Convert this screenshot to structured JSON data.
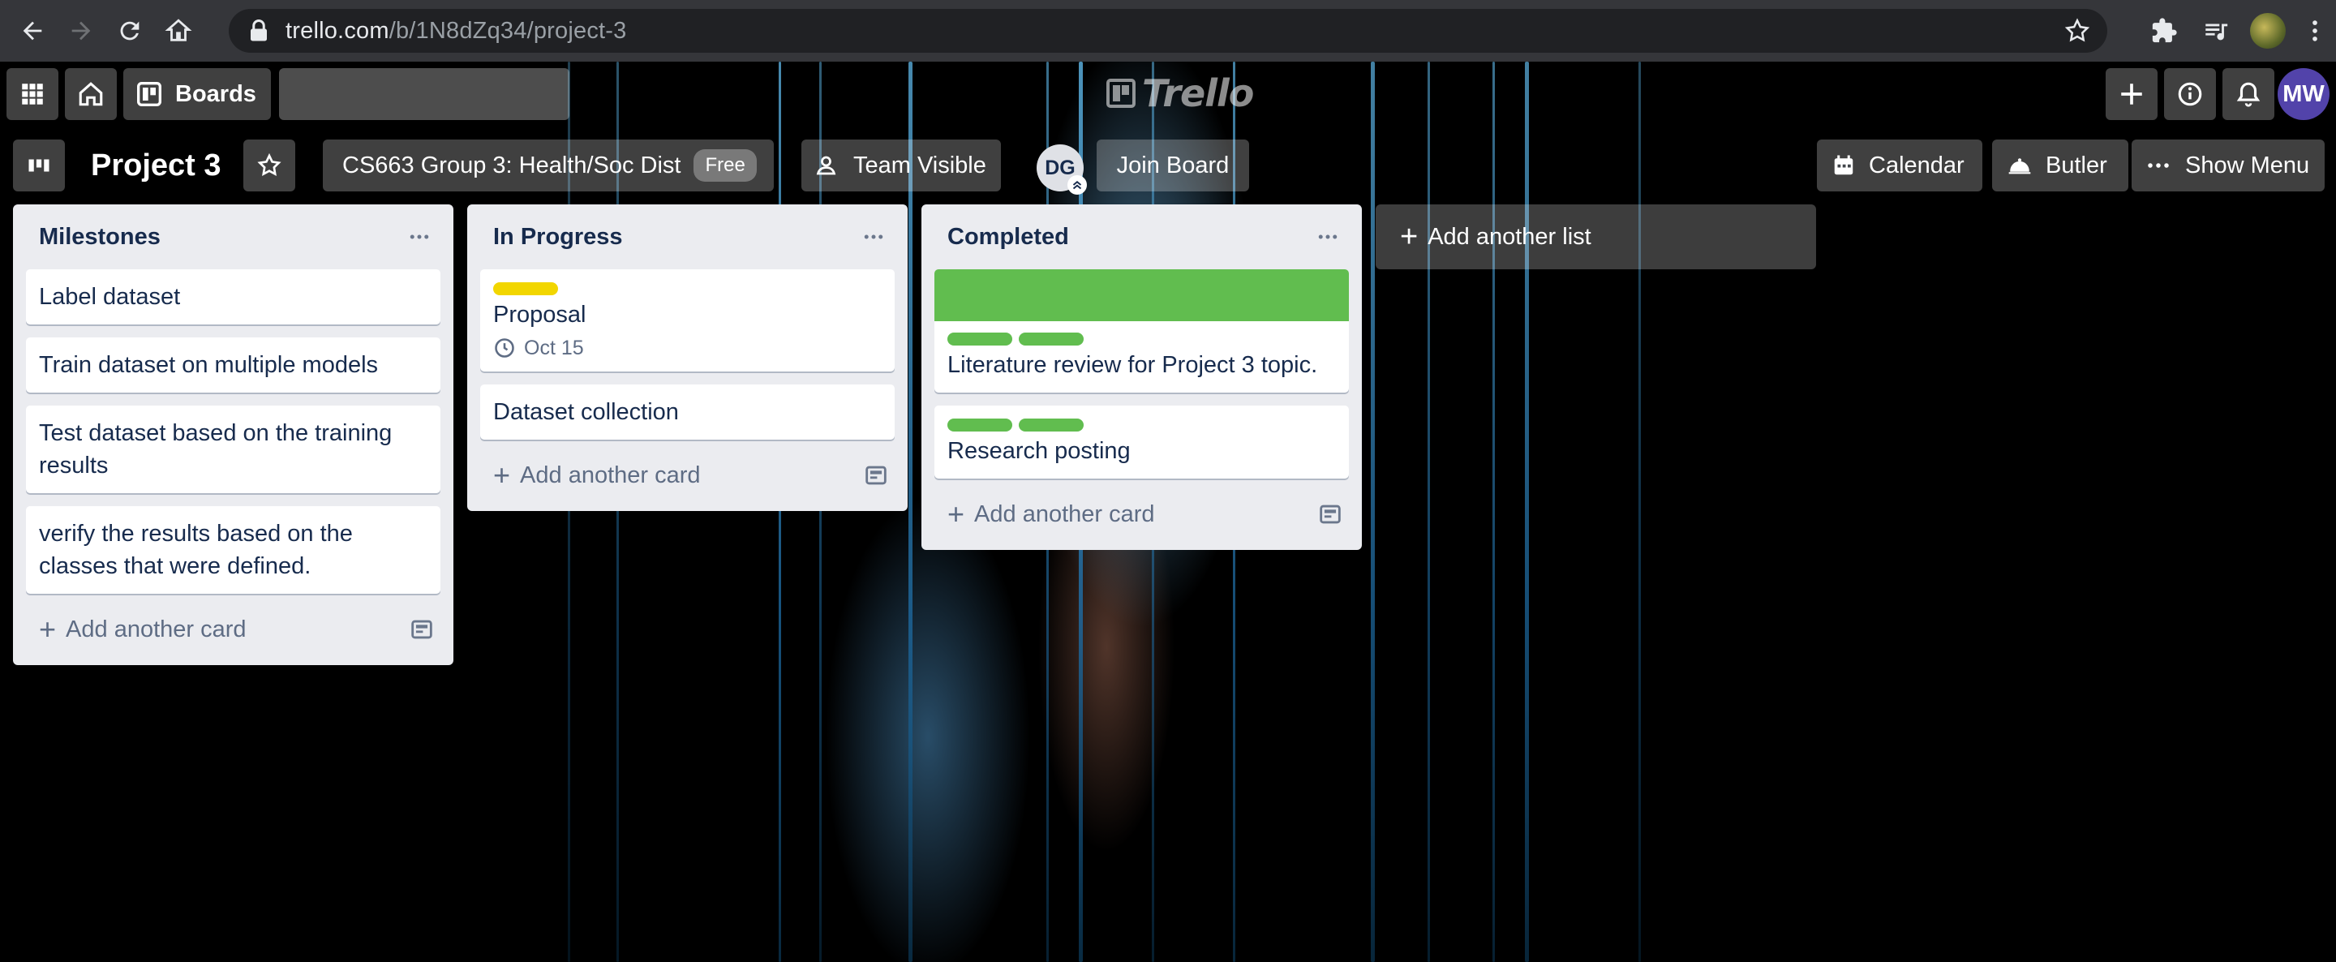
{
  "browser": {
    "url_host": "trello.com",
    "url_path": "/b/1N8dZq34/project-3"
  },
  "header": {
    "boards_label": "Boards",
    "search_placeholder": "",
    "logo_text": "Trello",
    "user_initials": "MW"
  },
  "board": {
    "title": "Project 3",
    "team_name": "CS663 Group 3: Health/Soc Dist",
    "team_plan": "Free",
    "visibility": "Team Visible",
    "member_initials": "DG",
    "join_label": "Join Board",
    "calendar_label": "Calendar",
    "butler_label": "Butler",
    "show_menu_label": "Show Menu"
  },
  "colors": {
    "label_yellow": "#f2d600",
    "label_green": "#61bd4f",
    "avatar_mw": "#5243aa"
  },
  "lists": [
    {
      "title": "Milestones",
      "cards": [
        {
          "title": "Label dataset"
        },
        {
          "title": "Train dataset on multiple models"
        },
        {
          "title": "Test dataset based on the training results"
        },
        {
          "title": "verify the results based on the classes that were defined."
        }
      ],
      "add_card_label": "Add another card"
    },
    {
      "title": "In Progress",
      "cards": [
        {
          "title": "Proposal",
          "labels": [
            "yellow"
          ],
          "due": "Oct 15"
        },
        {
          "title": "Dataset collection"
        }
      ],
      "add_card_label": "Add another card"
    },
    {
      "title": "Completed",
      "cards": [
        {
          "title": "Literature review for Project 3 topic.",
          "cover": "green",
          "labels": [
            "green",
            "green"
          ]
        },
        {
          "title": "Research posting",
          "labels": [
            "green",
            "green"
          ]
        }
      ],
      "add_card_label": "Add another card"
    }
  ],
  "add_list_label": "Add another list"
}
